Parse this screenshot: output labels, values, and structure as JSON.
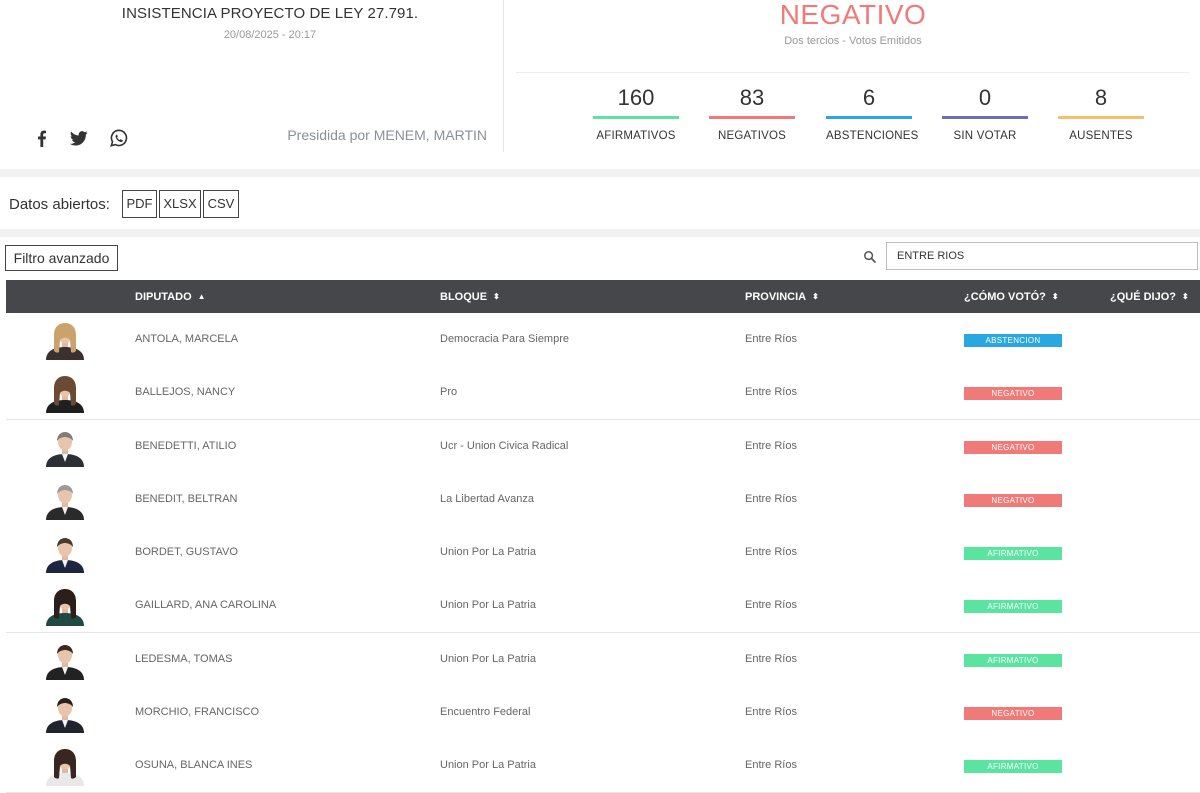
{
  "session": {
    "title": "INSISTENCIA PROYECTO DE LEY 27.791.",
    "datetime": "20/08/2025 - 20:17",
    "presided_by": "Presidida por MENEM, MARTIN",
    "result": "NEGATIVO",
    "result_color": "#f07a78",
    "majority": "Dos tercios - Votos Emitidos"
  },
  "social": [
    {
      "icon": "facebook-icon"
    },
    {
      "icon": "twitter-icon"
    },
    {
      "icon": "whatsapp-icon"
    }
  ],
  "stats": [
    {
      "value": "160",
      "label": "AFIRMATIVOS",
      "color": "#5be3a0"
    },
    {
      "value": "83",
      "label": "NEGATIVOS",
      "color": "#f07a78"
    },
    {
      "value": "6",
      "label": "ABSTENCIONES",
      "color": "#2aa7e0"
    },
    {
      "value": "0",
      "label": "SIN VOTAR",
      "color": "#6a6fb8"
    },
    {
      "value": "8",
      "label": "AUSENTES",
      "color": "#f5c06a"
    }
  ],
  "open_data": {
    "label": "Datos abiertos:",
    "formats": [
      "PDF",
      "XLSX",
      "CSV"
    ]
  },
  "filter": {
    "advanced_label": "Filtro avanzado",
    "search_value": "ENTRE RIOS"
  },
  "table": {
    "columns": [
      "DIPUTADO",
      "BLOQUE",
      "PROVINCIA",
      "¿CÓMO VOTÓ?",
      "¿QUÉ DIJO?"
    ],
    "rows": [
      {
        "name": "ANTOLA, MARCELA",
        "bloc": "Democracia Para Siempre",
        "province": "Entre Ríos",
        "vote": "ABSTENCION",
        "vote_color": "#2aa7e0",
        "gender": "f",
        "hair": "#c9a36a",
        "suit": "#3a3030"
      },
      {
        "name": "BALLEJOS, NANCY",
        "bloc": "Pro",
        "province": "Entre Ríos",
        "vote": "NEGATIVO",
        "vote_color": "#f07a78",
        "gender": "f",
        "hair": "#6b4a33",
        "suit": "#1f1f1f"
      },
      {
        "name": "BENEDETTI, ATILIO",
        "bloc": "Ucr - Union Civica Radical",
        "province": "Entre Ríos",
        "vote": "NEGATIVO",
        "vote_color": "#f07a78",
        "gender": "m",
        "hair": "#7d7d7d",
        "suit": "#2c2f36"
      },
      {
        "name": "BENEDIT, BELTRAN",
        "bloc": "La Libertad Avanza",
        "province": "Entre Ríos",
        "vote": "NEGATIVO",
        "vote_color": "#f07a78",
        "gender": "m",
        "hair": "#9a9a9a",
        "suit": "#2a2a2a"
      },
      {
        "name": "BORDET, GUSTAVO",
        "bloc": "Union Por La Patria",
        "province": "Entre Ríos",
        "vote": "AFIRMATIVO",
        "vote_color": "#5be3a0",
        "gender": "m",
        "hair": "#4a3a2e",
        "suit": "#1d2640"
      },
      {
        "name": "GAILLARD, ANA CAROLINA",
        "bloc": "Union Por La Patria",
        "province": "Entre Ríos",
        "vote": "AFIRMATIVO",
        "vote_color": "#5be3a0",
        "gender": "f",
        "hair": "#2a1f1a",
        "suit": "#1f4a44"
      },
      {
        "name": "LEDESMA, TOMAS",
        "bloc": "Union Por La Patria",
        "province": "Entre Ríos",
        "vote": "AFIRMATIVO",
        "vote_color": "#5be3a0",
        "gender": "m",
        "hair": "#3a2a22",
        "suit": "#222222"
      },
      {
        "name": "MORCHIO, FRANCISCO",
        "bloc": "Encuentro Federal",
        "province": "Entre Ríos",
        "vote": "NEGATIVO",
        "vote_color": "#f07a78",
        "gender": "m",
        "hair": "#2a2020",
        "suit": "#20242e"
      },
      {
        "name": "OSUNA, BLANCA INES",
        "bloc": "Union Por La Patria",
        "province": "Entre Ríos",
        "vote": "AFIRMATIVO",
        "vote_color": "#5be3a0",
        "gender": "f",
        "hair": "#3a2620",
        "suit": "#e8e8e8"
      }
    ]
  }
}
